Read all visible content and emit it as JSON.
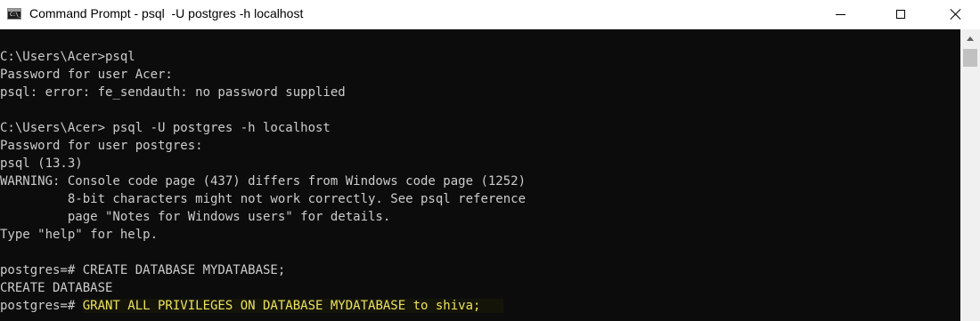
{
  "window": {
    "title": "Command Prompt - psql  -U postgres -h localhost",
    "icon": "cmd-icon",
    "icon_text": "C:\\_"
  },
  "console": {
    "text_color": "#cccccc",
    "background": "#0c0c0c",
    "highlight_color": "#ede35a",
    "lines": [
      "",
      "C:\\Users\\Acer>psql",
      "Password for user Acer:",
      "psql: error: fe_sendauth: no password supplied",
      "",
      "C:\\Users\\Acer> psql -U postgres -h localhost",
      "Password for user postgres:",
      "psql (13.3)",
      "WARNING: Console code page (437) differs from Windows code page (1252)",
      "         8-bit characters might not work correctly. See psql reference",
      "         page \"Notes for Windows users\" for details.",
      "Type \"help\" for help.",
      "",
      "postgres=# CREATE DATABASE MYDATABASE;",
      "CREATE DATABASE"
    ],
    "last_line": {
      "prompt": "postgres=# ",
      "command": "GRANT ALL PRIVILEGES ON DATABASE MYDATABASE to shiva;"
    }
  }
}
